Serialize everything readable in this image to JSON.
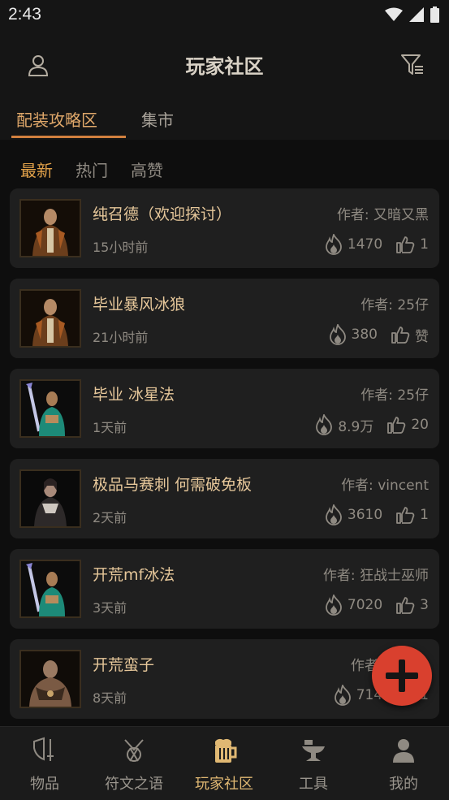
{
  "status": {
    "time": "2:43"
  },
  "header": {
    "title": "玩家社区"
  },
  "tabs": [
    {
      "label": "配装攻略区",
      "active": true
    },
    {
      "label": "集市",
      "active": false
    }
  ],
  "subtabs": [
    {
      "label": "最新",
      "active": true
    },
    {
      "label": "热门",
      "active": false
    },
    {
      "label": "高赞",
      "active": false
    }
  ],
  "posts": [
    {
      "title": "纯召德（欢迎探讨）",
      "author": "作者: 又暗又黑",
      "time": "15小时前",
      "heat": "1470",
      "likes": "1",
      "avatar": "druid-portrait"
    },
    {
      "title": "毕业暴风冰狼",
      "author": "作者: 25仔",
      "time": "21小时前",
      "heat": "380",
      "likes": "赞",
      "avatar": "druid-portrait"
    },
    {
      "title": "毕业 冰星法",
      "author": "作者: 25仔",
      "time": "1天前",
      "heat": "8.9万",
      "likes": "20",
      "avatar": "sorceress-portrait"
    },
    {
      "title": "极品马赛刺 何需破免板",
      "author": "作者: vincent",
      "time": "2天前",
      "heat": "3610",
      "likes": "1",
      "avatar": "assassin-portrait"
    },
    {
      "title": "开荒mf冰法",
      "author": "作者: 狂战士巫师",
      "time": "3天前",
      "heat": "7020",
      "likes": "3",
      "avatar": "sorceress-portrait"
    },
    {
      "title": "开荒蛮子",
      "author": "作者: 闪电之",
      "time": "8天前",
      "heat": "714",
      "likes": "1",
      "avatar": "barbarian-portrait"
    }
  ],
  "nav": [
    {
      "label": "物品",
      "icon": "shield-sword-icon",
      "active": false
    },
    {
      "label": "符文之语",
      "icon": "rune-icon",
      "active": false
    },
    {
      "label": "玩家社区",
      "icon": "beer-mug-icon",
      "active": true
    },
    {
      "label": "工具",
      "icon": "anvil-icon",
      "active": false
    },
    {
      "label": "我的",
      "icon": "person-icon",
      "active": false
    }
  ],
  "colors": {
    "accent": "#e0a86a",
    "fab": "#d9402e",
    "background": "#0e0e0e",
    "card": "#1f1f1f"
  }
}
